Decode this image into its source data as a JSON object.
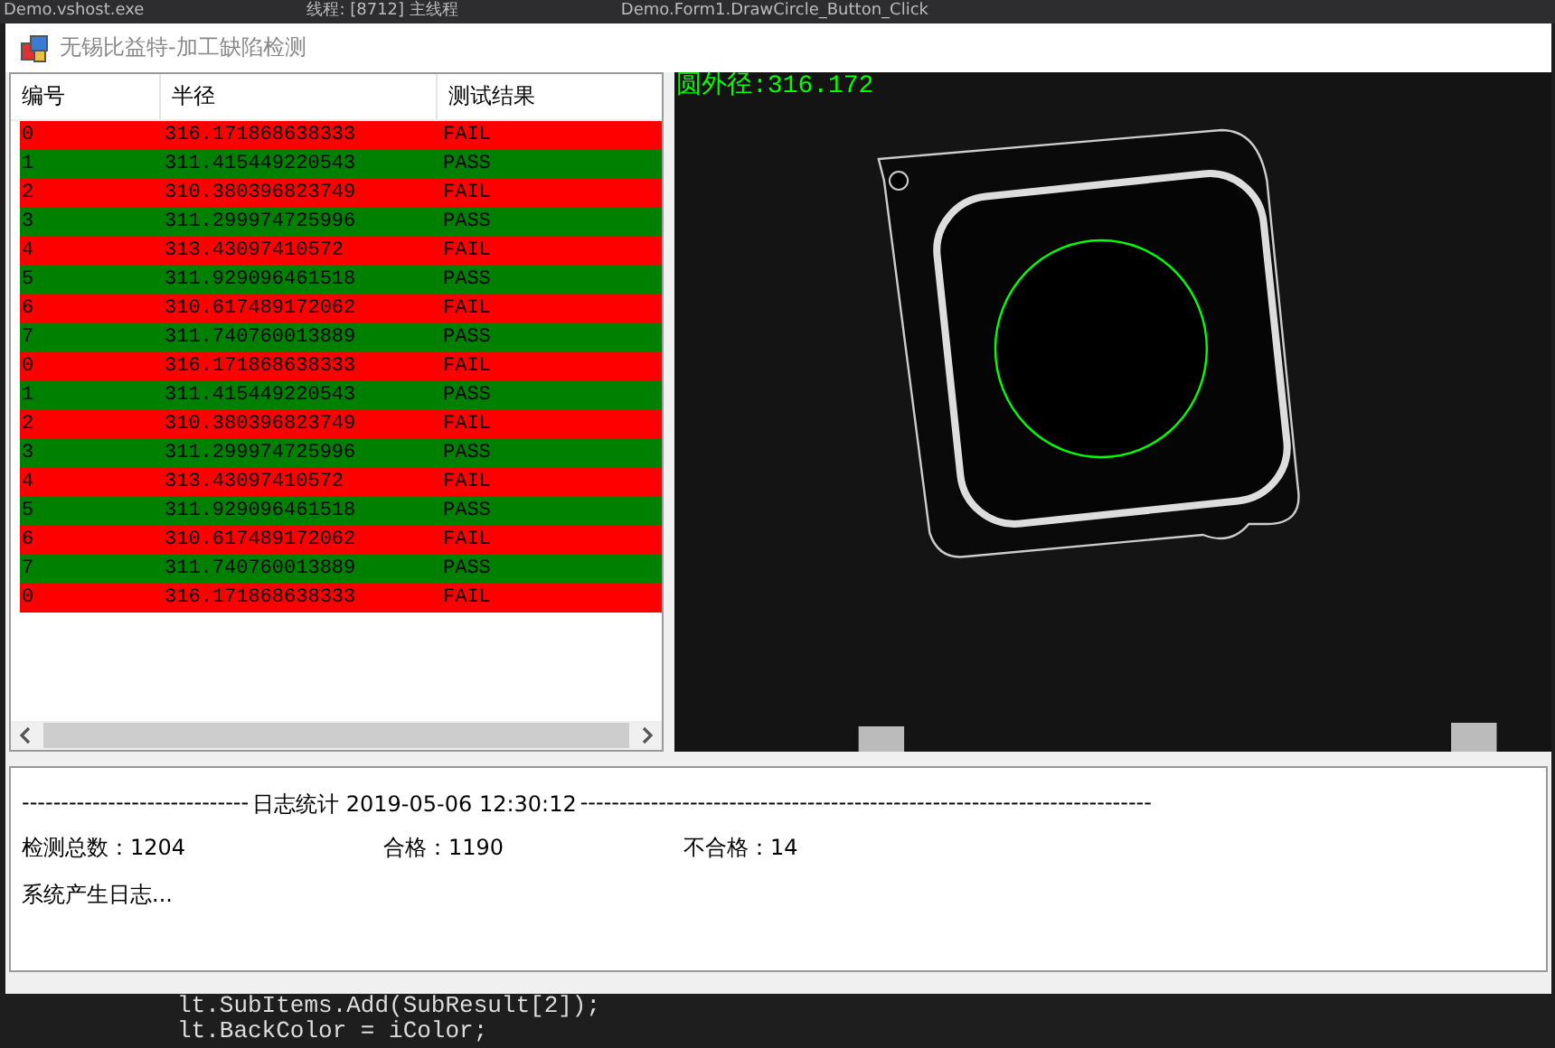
{
  "background_ide": {
    "top_tabs": [
      "Demo.vshost.exe",
      "线程: [8712] 主线程",
      "Demo.Form1.DrawCircle_Button_Click"
    ],
    "code_lines": [
      "lt.SubItems.Add(SubResult[2]);",
      "lt.BackColor = iColor;"
    ]
  },
  "window": {
    "title": "无锡比益特-加工缺陷检测"
  },
  "table": {
    "columns": [
      "编号",
      "半径",
      "测试结果"
    ],
    "rows": [
      {
        "cells": [
          "0",
          "316.171868638333",
          "FAIL"
        ],
        "color": "#ff0000"
      },
      {
        "cells": [
          "1",
          "311.415449220543",
          "PASS"
        ],
        "color": "#008000"
      },
      {
        "cells": [
          "2",
          "310.380396823749",
          "FAIL"
        ],
        "color": "#ff0000"
      },
      {
        "cells": [
          "3",
          "311.299974725996",
          "PASS"
        ],
        "color": "#008000"
      },
      {
        "cells": [
          "4",
          "313.43097410572",
          "FAIL"
        ],
        "color": "#ff0000"
      },
      {
        "cells": [
          "5",
          "311.929096461518",
          "PASS"
        ],
        "color": "#008000"
      },
      {
        "cells": [
          "6",
          "310.617489172062",
          "FAIL"
        ],
        "color": "#ff0000"
      },
      {
        "cells": [
          "7",
          "311.740760013889",
          "PASS"
        ],
        "color": "#008000"
      },
      {
        "cells": [
          "0",
          "316.171868638333",
          "FAIL"
        ],
        "color": "#ff0000"
      },
      {
        "cells": [
          "1",
          "311.415449220543",
          "PASS"
        ],
        "color": "#008000"
      },
      {
        "cells": [
          "2",
          "310.380396823749",
          "FAIL"
        ],
        "color": "#ff0000"
      },
      {
        "cells": [
          "3",
          "311.299974725996",
          "PASS"
        ],
        "color": "#008000"
      },
      {
        "cells": [
          "4",
          "313.43097410572",
          "FAIL"
        ],
        "color": "#ff0000"
      },
      {
        "cells": [
          "5",
          "311.929096461518",
          "PASS"
        ],
        "color": "#008000"
      },
      {
        "cells": [
          "6",
          "310.617489172062",
          "FAIL"
        ],
        "color": "#ff0000"
      },
      {
        "cells": [
          "7",
          "311.740760013889",
          "PASS"
        ],
        "color": "#008000"
      },
      {
        "cells": [
          "0",
          "316.171868638333",
          "FAIL"
        ],
        "color": "#ff0000"
      }
    ]
  },
  "image": {
    "overlay_text": "圆外径:316.172"
  },
  "log": {
    "header_left": "-----------------------------",
    "header_title": "日志统计 2019-05-06 12:30:12",
    "header_right": "-------------------------------------------------------------------------",
    "stats": [
      {
        "label": "检测总数：",
        "value": "1204"
      },
      {
        "label": "合格：",
        "value": "1190"
      },
      {
        "label": "不合格：",
        "value": "14"
      }
    ],
    "message": "系统产生日志..."
  }
}
